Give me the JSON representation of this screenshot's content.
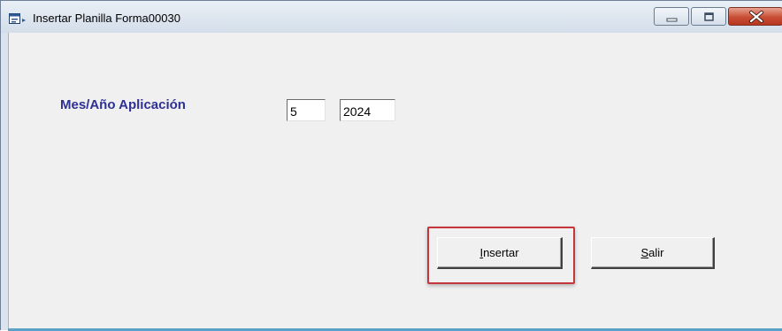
{
  "window": {
    "title": "Insertar Planilla Forma00030",
    "icon": "form-window-icon"
  },
  "caption_buttons": {
    "minimize": "minimize-icon",
    "maximize": "maximize-icon",
    "close": "close-icon"
  },
  "form": {
    "mes_anio_label": "Mes/Año Aplicación",
    "month_value": "5",
    "year_value": "2024"
  },
  "buttons": {
    "insertar": {
      "accel": "I",
      "rest": "nsertar"
    },
    "salir": {
      "accel": "S",
      "rest": "alir"
    }
  },
  "colors": {
    "label_text": "#2e3192",
    "highlight_border": "#c7353c",
    "client_bg": "#f0f0f0",
    "close_button": "#c74d34"
  }
}
